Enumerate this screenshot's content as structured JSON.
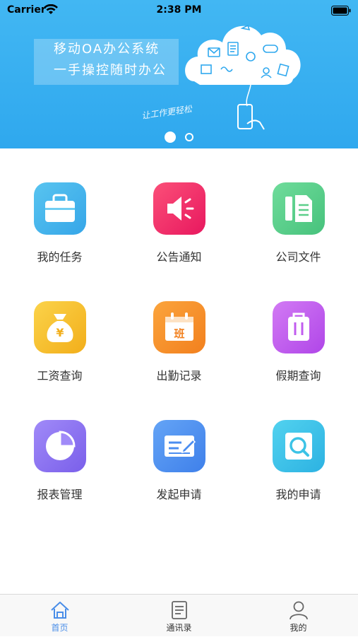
{
  "status_bar": {
    "carrier": "Carrier",
    "time": "2:38 PM"
  },
  "banner": {
    "slogan_line1": "移动OA办公系统",
    "slogan_line2": "一手操控随时办公",
    "handwriting": "让工作更轻松",
    "pages": 2,
    "active_page": 1
  },
  "grid": [
    {
      "label": "我的任务",
      "icon": "briefcase-icon",
      "color": "#3fb5e8"
    },
    {
      "label": "公告通知",
      "icon": "speaker-icon",
      "color": "#f2306e"
    },
    {
      "label": "公司文件",
      "icon": "document-icon",
      "color": "#5ccf8a"
    },
    {
      "label": "工资查询",
      "icon": "money-bag-icon",
      "color": "#f7c02b"
    },
    {
      "label": "出勤记录",
      "icon": "calendar-shift-icon",
      "color": "#f7912a"
    },
    {
      "label": "假期查询",
      "icon": "luggage-icon",
      "color": "#c15cef"
    },
    {
      "label": "报表管理",
      "icon": "pie-chart-icon",
      "color": "#8a6ff0"
    },
    {
      "label": "发起申请",
      "icon": "edit-form-icon",
      "color": "#4b8df0"
    },
    {
      "label": "我的申请",
      "icon": "search-document-icon",
      "color": "#3cc3e6"
    }
  ],
  "tile_glyph_ban": "班",
  "tile_glyph_yen": "¥",
  "tabbar": [
    {
      "label": "首页",
      "icon": "home-icon",
      "active": true
    },
    {
      "label": "通讯录",
      "icon": "contacts-list-icon",
      "active": false
    },
    {
      "label": "我的",
      "icon": "profile-icon",
      "active": false
    }
  ],
  "colors": {
    "accent": "#4a8ee8",
    "banner": "#3aaff0"
  }
}
